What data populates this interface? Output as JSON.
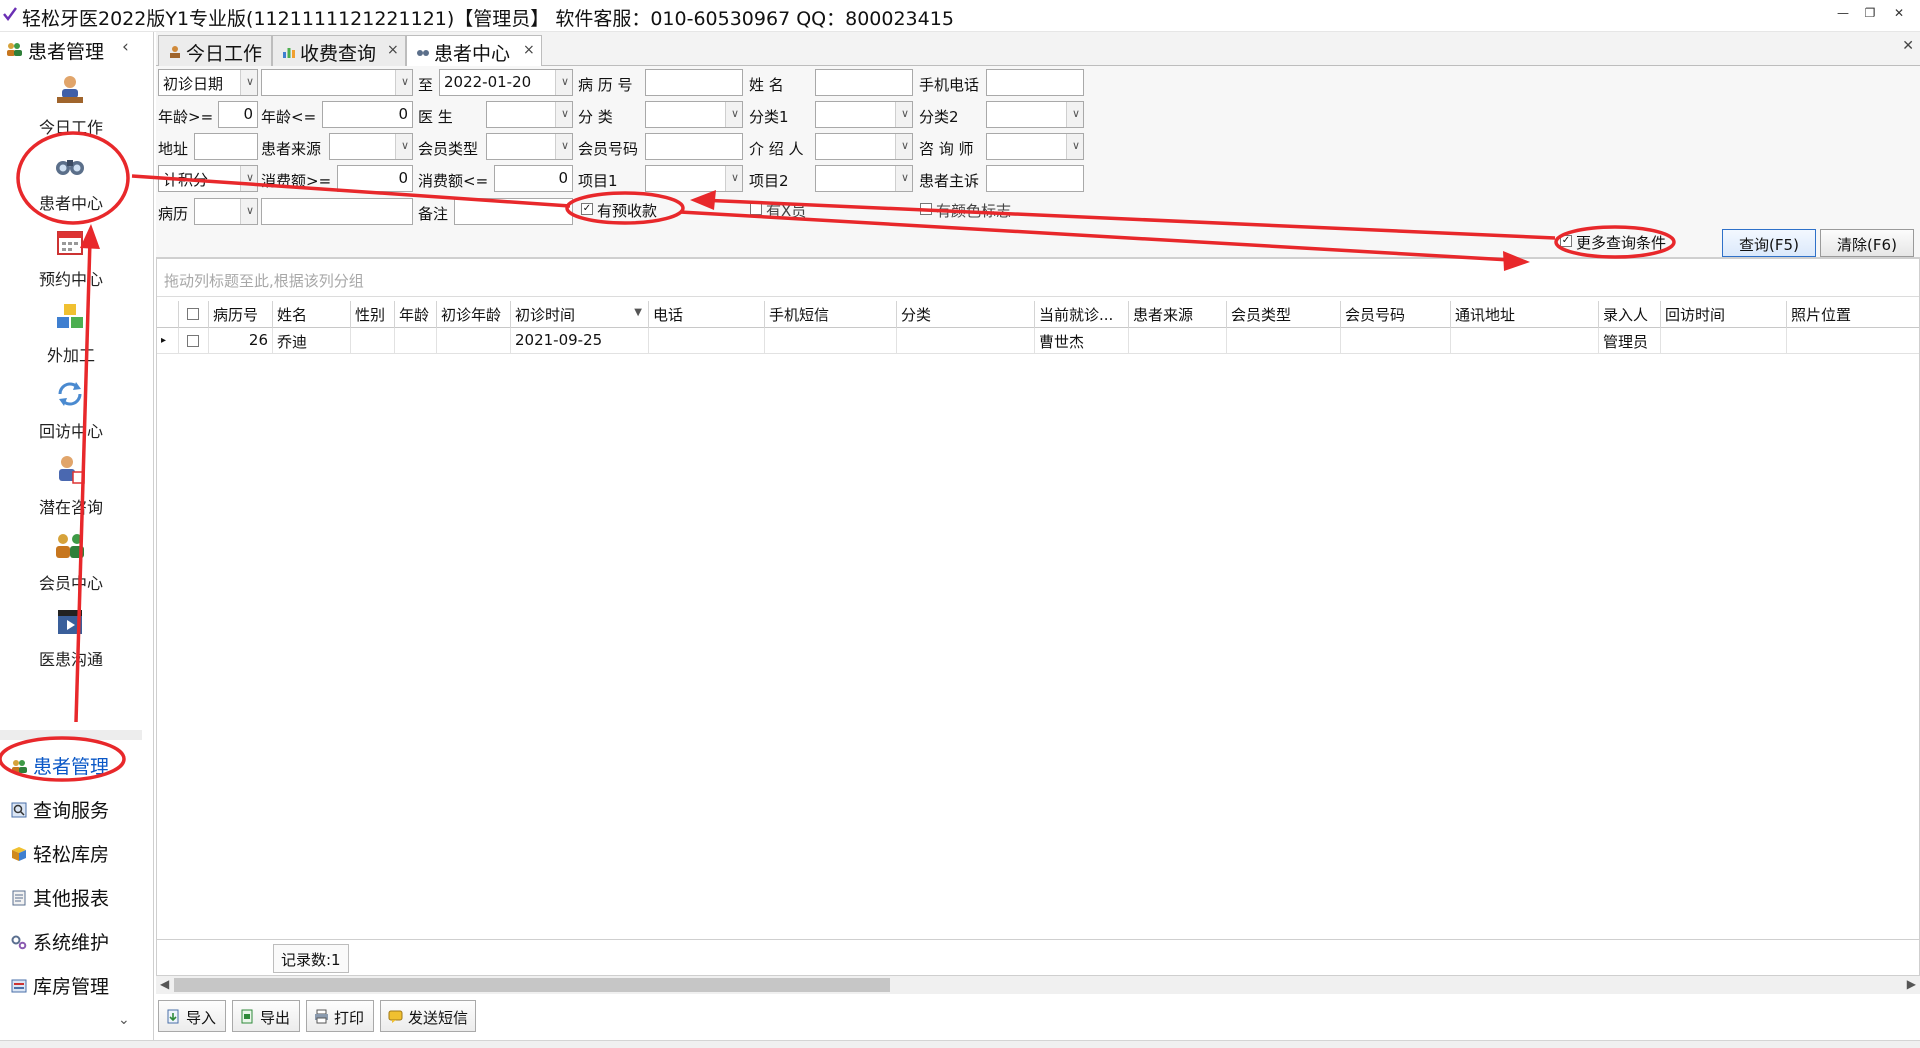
{
  "window": {
    "title": "轻松牙医2022版Y1专业版(1121111121221121)【管理员】    软件客服：010-60530967 QQ：800023415",
    "minimize": "—",
    "restore": "❐",
    "close": "✕"
  },
  "sidebar": {
    "header": "患者管理",
    "collapse": "‹",
    "modules": [
      {
        "label": "今日工作",
        "icon": "person-at-desk-icon"
      },
      {
        "label": "患者中心",
        "icon": "binoculars-icon"
      },
      {
        "label": "预约中心",
        "icon": "calendar-icon"
      },
      {
        "label": "外加工",
        "icon": "cubes-icon"
      },
      {
        "label": "回访中心",
        "icon": "refresh-icon"
      },
      {
        "label": "潜在咨询",
        "icon": "person-calendar-icon"
      },
      {
        "label": "会员中心",
        "icon": "group-icon"
      },
      {
        "label": "医患沟通",
        "icon": "clapperboard-icon"
      }
    ],
    "nav": [
      {
        "label": "患者管理",
        "icon": "users-icon",
        "active": true
      },
      {
        "label": "查询服务",
        "icon": "search-icon"
      },
      {
        "label": "轻松库房",
        "icon": "box-icon"
      },
      {
        "label": "其他报表",
        "icon": "report-icon"
      },
      {
        "label": "系统维护",
        "icon": "gears-icon"
      },
      {
        "label": "库房管理",
        "icon": "warehouse-icon"
      }
    ],
    "more": "⌄"
  },
  "tabs": [
    {
      "label": "今日工作",
      "closable": false
    },
    {
      "label": "收费查询",
      "closable": true
    },
    {
      "label": "患者中心",
      "closable": true,
      "active": true
    }
  ],
  "tab_close": "×",
  "filter": {
    "date_type": "初诊日期",
    "date_from": "",
    "to_label": "至",
    "date_to": "2022-01-20",
    "record_no_label": "病 历 号",
    "record_no": "",
    "name_label": "姓    名",
    "name": "",
    "phone_label": "手机电话",
    "phone": "",
    "age_min_label": "年龄>=",
    "age_min": "0",
    "age_max_label": "年龄<=",
    "age_max": "0",
    "doctor_label": "医    生",
    "doctor": "",
    "category_label": "分    类",
    "category": "",
    "cat1_label": "分类1",
    "cat1": "",
    "cat2_label": "分类2",
    "cat2": "",
    "address_label": "地址",
    "address": "",
    "source_label": "患者来源",
    "source": "",
    "member_type_label": "会员类型",
    "member_type": "",
    "member_no_label": "会员号码",
    "member_no": "",
    "referrer_label": "介 绍 人",
    "referrer": "",
    "consultant_label": "咨 询 师",
    "consultant": "",
    "points_type": "计积分",
    "spend_min_label": "消费额>=",
    "spend_min": "0",
    "spend_max_label": "消费额<=",
    "spend_max": "0",
    "item1_label": "项目1",
    "item1": "",
    "item2_label": "项目2",
    "item2": "",
    "complaint_label": "患者主诉",
    "complaint": "",
    "history_label": "病历",
    "history": "",
    "history_text": "",
    "remark_label": "备注",
    "remark": "",
    "chk_prepay": "有预收款",
    "chk_unknown1": "有X员",
    "chk_unknown2": "有颜色标志",
    "more_conditions": "更多查询条件",
    "query_btn": "查询(F5)",
    "clear_btn": "清除(F6)"
  },
  "grid": {
    "group_hint": "拖动列标题至此,根据该列分组",
    "columns": [
      "病历号",
      "姓名",
      "性别",
      "年龄",
      "初诊年龄",
      "初诊时间",
      "电话",
      "手机短信",
      "分类",
      "当前就诊...",
      "患者来源",
      "会员类型",
      "会员号码",
      "通讯地址",
      "录入人",
      "回访时间",
      "照片位置"
    ],
    "rows": [
      {
        "record_no": "26",
        "name": "乔迪",
        "gender": "",
        "age": "",
        "first_age": "",
        "first_date": "2021-09-25",
        "phone": "",
        "sms": "",
        "category": "",
        "current_doctor": "曹世杰",
        "source": "",
        "member_type": "",
        "member_no": "",
        "address": "",
        "entered_by": "管理员",
        "followup": "",
        "photo": ""
      }
    ],
    "record_count": "记录数:1"
  },
  "toolbar": {
    "import": "导入",
    "export": "导出",
    "print": "打印",
    "sms": "发送短信"
  },
  "status": {
    "zoom": "0.55"
  },
  "colors": {
    "annotation": "#e8282b",
    "active_nav": "#0b58c7"
  }
}
